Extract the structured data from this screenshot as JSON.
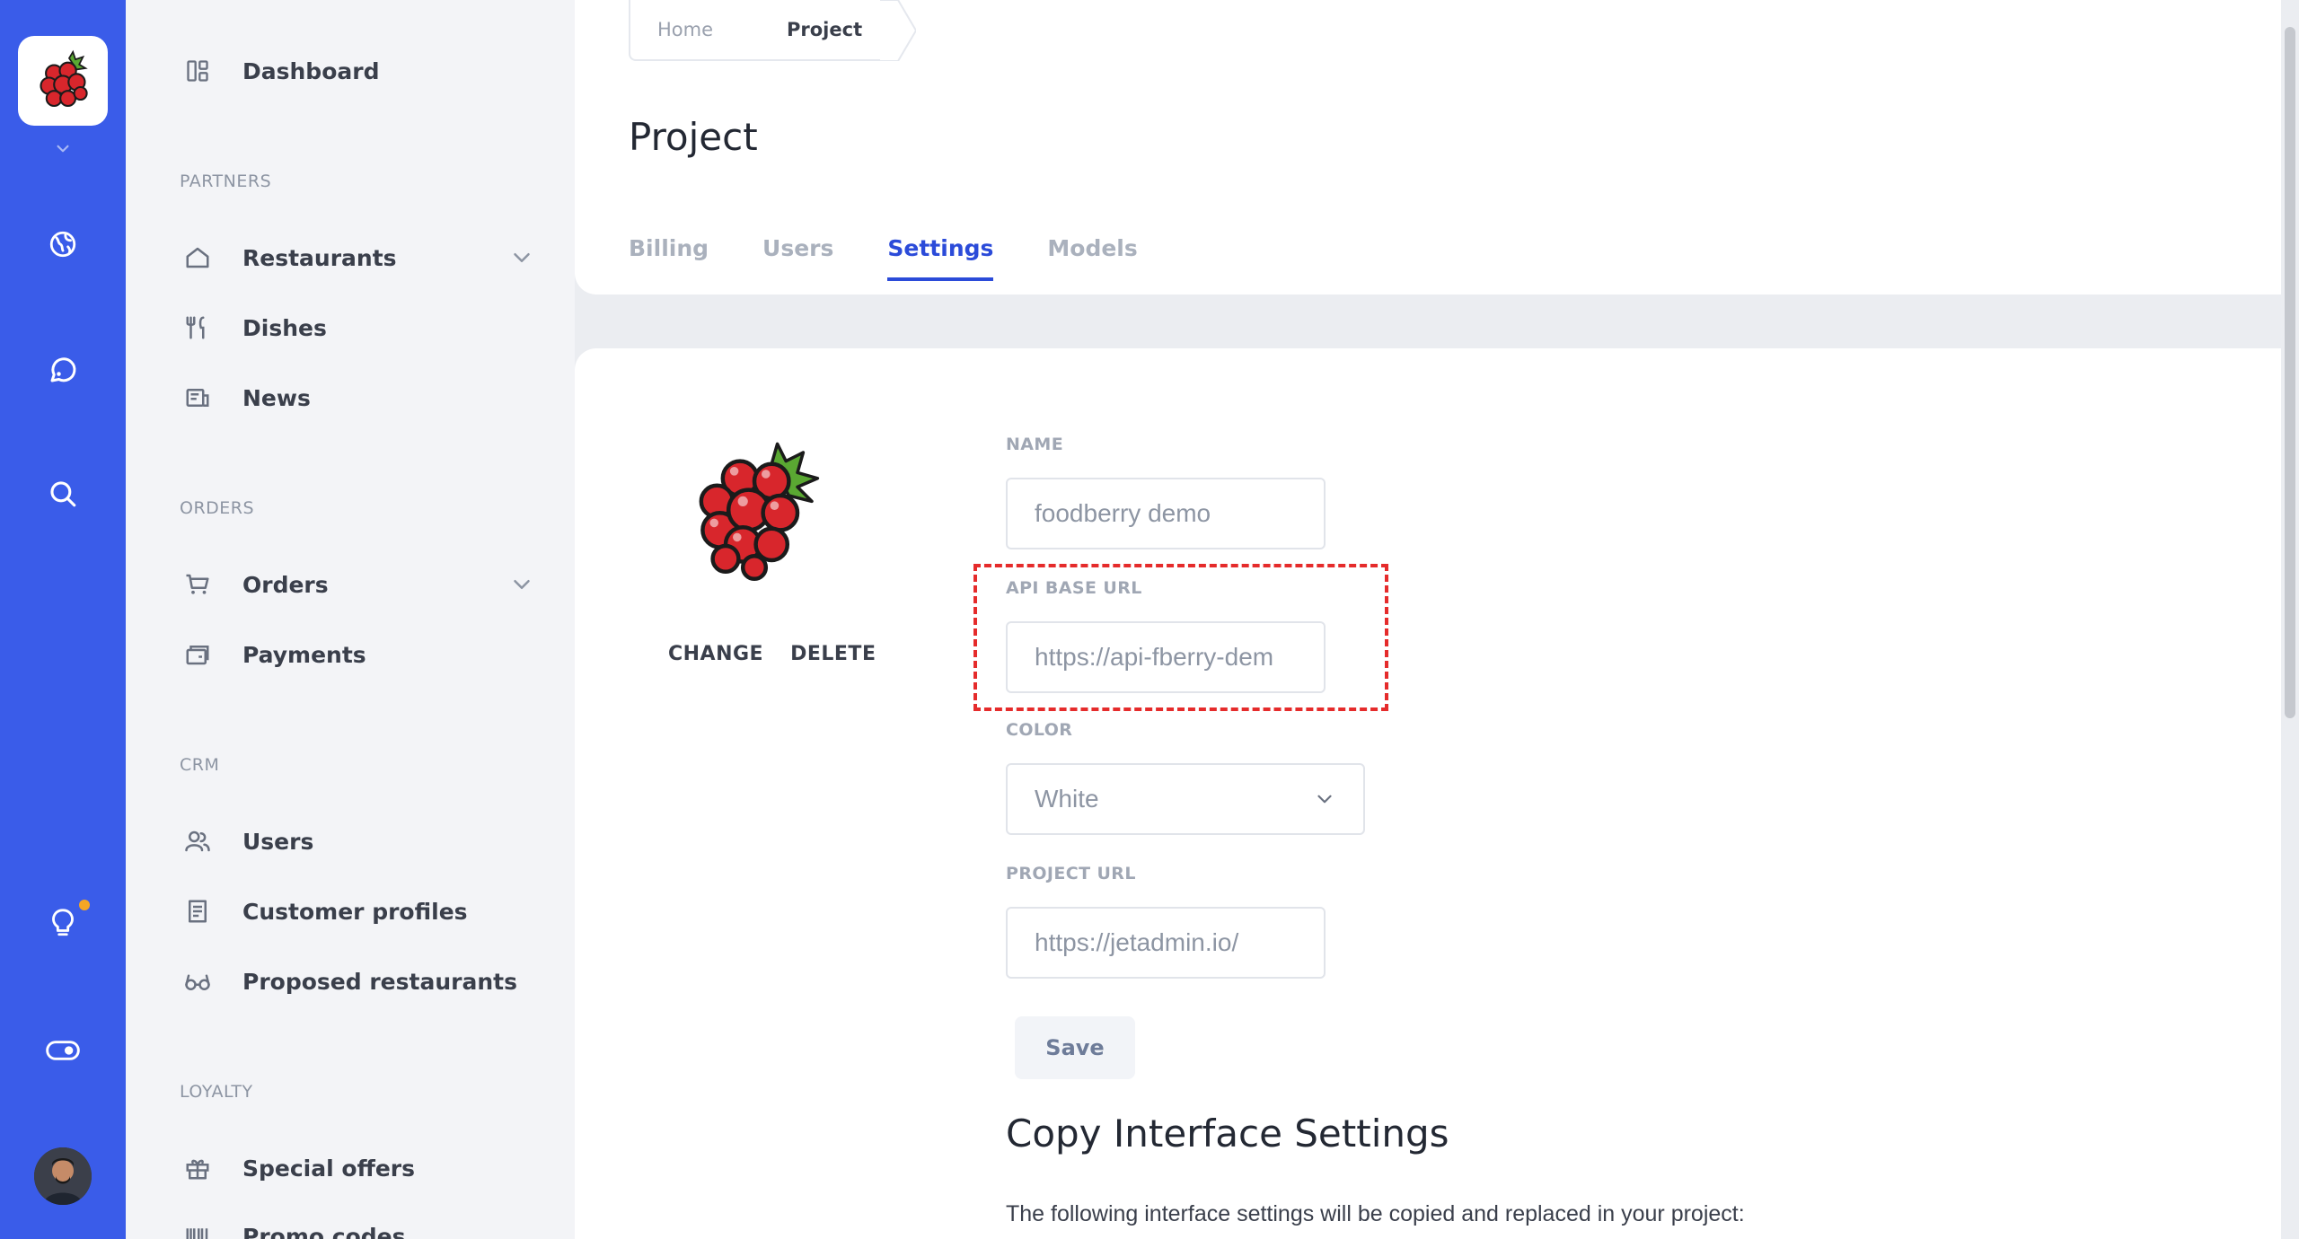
{
  "sidebar": {
    "items": [
      {
        "label": "Dashboard"
      },
      {
        "label": "Restaurants"
      },
      {
        "label": "Dishes"
      },
      {
        "label": "News"
      },
      {
        "label": "Orders"
      },
      {
        "label": "Payments"
      },
      {
        "label": "Users"
      },
      {
        "label": "Customer profiles"
      },
      {
        "label": "Proposed restaurants"
      },
      {
        "label": "Special offers"
      },
      {
        "label": "Promo codes"
      }
    ],
    "sections": [
      "PARTNERS",
      "ORDERS",
      "CRM",
      "LOYALTY"
    ]
  },
  "rail": {
    "icons": [
      "raspberry-logo-icon",
      "chevron-down-icon",
      "globe-icon",
      "chat-icon",
      "search-icon",
      "lightbulb-icon",
      "toggle-icon",
      "user-avatar"
    ]
  },
  "breadcrumb": {
    "home": "Home",
    "current": "Project"
  },
  "page": {
    "title": "Project"
  },
  "tabs": [
    "Billing",
    "Users",
    "Settings",
    "Models"
  ],
  "active_tab": "Settings",
  "logo_actions": {
    "change": "CHANGE",
    "delete": "DELETE"
  },
  "form": {
    "name_label": "NAME",
    "name_value": "foodberry demo",
    "api_label": "API BASE URL",
    "api_value": "https://api-fberry-dem",
    "color_label": "COLOR",
    "color_value": "White",
    "project_url_label": "PROJECT URL",
    "project_url_value": "https://jetadmin.io/",
    "save_label": "Save"
  },
  "copy_section": {
    "heading": "Copy Interface Settings",
    "description": "The following interface settings will be copied and replaced in your project:"
  },
  "colors": {
    "rail": "#3a5ce9",
    "accent": "#2b4bd9",
    "highlight": "#e52b2b",
    "notify": "#f5a623"
  }
}
